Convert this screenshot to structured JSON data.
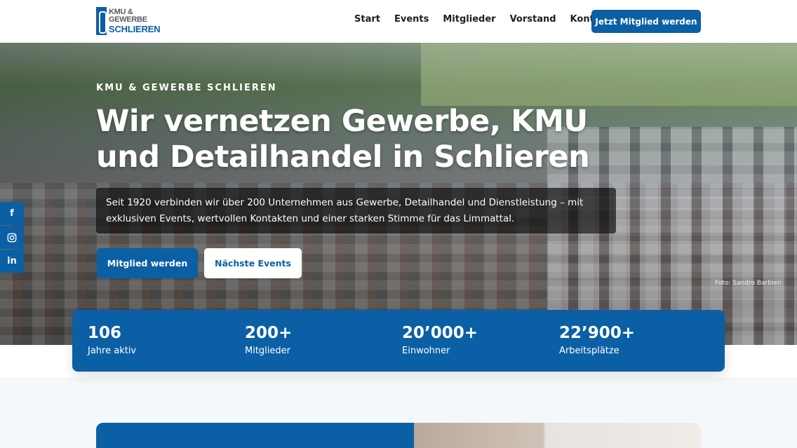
{
  "header": {
    "logo": {
      "line1": "KMU & GEWERBE",
      "line2": "SCHLIEREN"
    },
    "nav": [
      {
        "label": "Start"
      },
      {
        "label": "Events"
      },
      {
        "label": "Mitglieder"
      },
      {
        "label": "Vorstand"
      },
      {
        "label": "Kontakt"
      }
    ],
    "cta_label": "Jetzt Mitglied werden"
  },
  "hero": {
    "eyebrow": "KMU & GEWERBE SCHLIEREN",
    "headline": "Wir vernetzen Gewerbe, KMU und Detailhandel in Schlieren",
    "intro": "Seit 1920 verbinden wir über 200 Unternehmen aus Gewerbe, Detailhandel und Dienstleistung – mit exklusiven Events, wertvollen Kontakten und einer starken Stimme für das Limmattal.",
    "primary_button": "Mitglied werden",
    "secondary_button": "Nächste Events",
    "photo_credit": "Foto: Sandro Barbieri"
  },
  "social": [
    {
      "icon": "facebook-icon",
      "glyph": "f"
    },
    {
      "icon": "instagram-icon",
      "glyph": ""
    },
    {
      "icon": "linkedin-icon",
      "glyph": "in"
    }
  ],
  "stats": [
    {
      "value": "106",
      "label": "Jahre aktiv"
    },
    {
      "value": "200+",
      "label": "Mitglieder"
    },
    {
      "value": "20’000+",
      "label": "Einwohner"
    },
    {
      "value": "22’900+",
      "label": "Arbeitsplätze"
    }
  ],
  "colors": {
    "brand_blue": "#0b5fa5",
    "logo_gray": "#5a5a5a"
  }
}
